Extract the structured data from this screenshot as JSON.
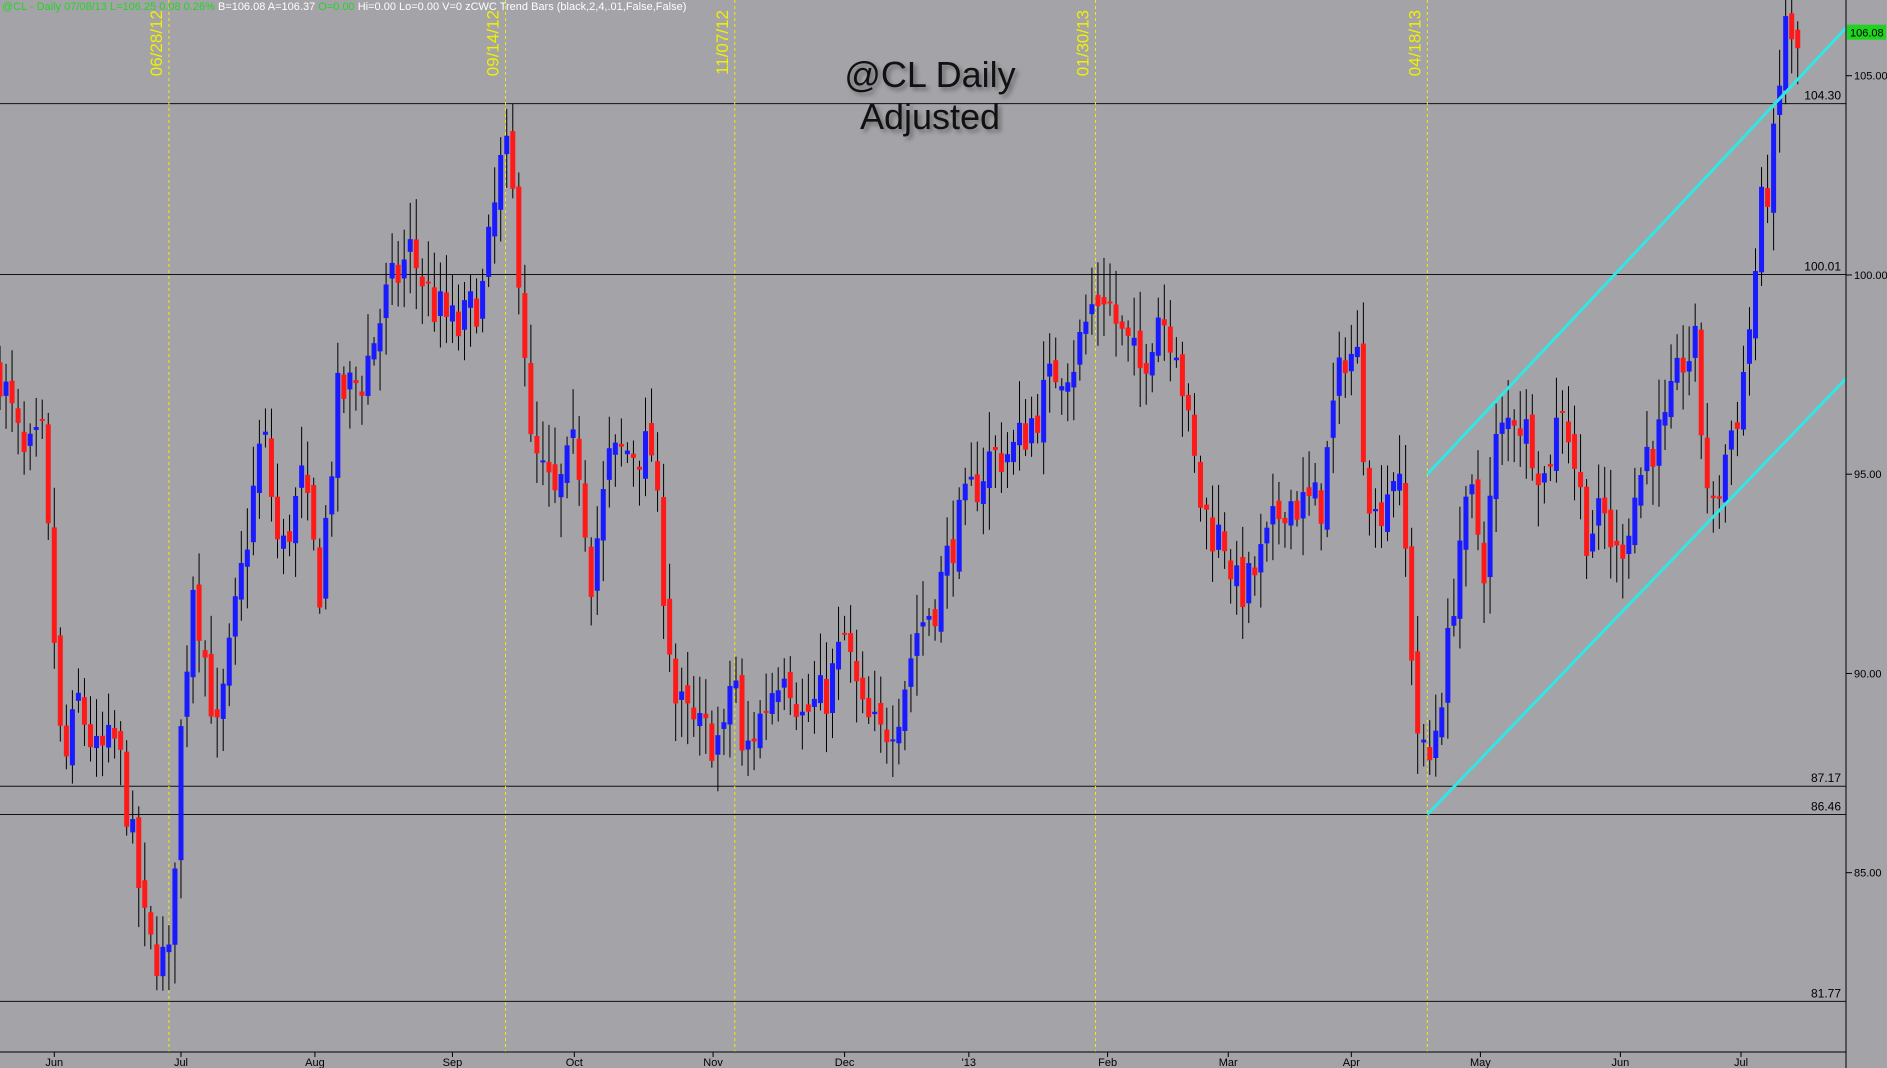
{
  "header": {
    "quote_prefix": "@CL - Daily  07/08/13  L=106.25  0.08  0.26%",
    "bid": "B=106.08",
    "ask": "A=106.37",
    "extra": "O=0.00",
    "stats": "Hi=0.00  Lo=0.00  V=0",
    "indicator": "zCWC Trend Bars (black,2,4,.01,False,False)"
  },
  "title": {
    "line1": "@CL Daily",
    "line2": "Adjusted"
  },
  "colors": {
    "background": "#a3a3a8",
    "up": "#1a1aff",
    "down": "#ff1a1a",
    "channel": "#33e6e6",
    "marker": "#f0f000",
    "level": "#111111"
  },
  "chart_data": {
    "type": "candlestick",
    "ylim": [
      80.5,
      106.9
    ],
    "xlim": [
      0,
      1530
    ],
    "y_ticks": [
      {
        "value": 85,
        "label": "85.00"
      },
      {
        "value": 90,
        "label": "90.00"
      },
      {
        "value": 95,
        "label": "95.00"
      },
      {
        "value": 100,
        "label": "100.00"
      },
      {
        "value": 105,
        "label": "105.00"
      }
    ],
    "last_price": {
      "value": 106.08,
      "label": "106.08"
    },
    "x_ticks": [
      {
        "label": "Jun",
        "x": 45
      },
      {
        "label": "Jul",
        "x": 150
      },
      {
        "label": "Aug",
        "x": 261
      },
      {
        "label": "Sep",
        "x": 375
      },
      {
        "label": "Oct",
        "x": 476
      },
      {
        "label": "Nov",
        "x": 591
      },
      {
        "label": "Dec",
        "x": 700
      },
      {
        "label": "'13",
        "x": 803
      },
      {
        "label": "Feb",
        "x": 918
      },
      {
        "label": "Mar",
        "x": 1018
      },
      {
        "label": "Apr",
        "x": 1120
      },
      {
        "label": "May",
        "x": 1227
      },
      {
        "label": "Jun",
        "x": 1343
      },
      {
        "label": "Jul",
        "x": 1443
      }
    ],
    "horizontal_levels": [
      {
        "value": 104.3,
        "label": "104.30"
      },
      {
        "value": 100.01,
        "label": "100.01"
      },
      {
        "value": 87.17,
        "label": "87.17"
      },
      {
        "value": 86.46,
        "label": "86.46"
      },
      {
        "value": 81.77,
        "label": "81.77"
      }
    ],
    "date_markers": [
      {
        "label": "06/28/12",
        "x": 140
      },
      {
        "label": "09/14/12",
        "x": 419
      },
      {
        "label": "11/07/12",
        "x": 609
      },
      {
        "label": "01/30/13",
        "x": 908
      },
      {
        "label": "04/18/13",
        "x": 1183
      }
    ],
    "channel_lines": [
      {
        "x1": 1183,
        "y1": 95.0,
        "x2": 1530,
        "y2": 106.2
      },
      {
        "x1": 1183,
        "y1": 86.46,
        "x2": 1530,
        "y2": 97.4
      }
    ],
    "price_anchors": [
      [
        0,
        97.6
      ],
      [
        20,
        95.3
      ],
      [
        35,
        95.8
      ],
      [
        52,
        87.4
      ],
      [
        65,
        89.3
      ],
      [
        80,
        87.9
      ],
      [
        97,
        88.3
      ],
      [
        112,
        85.3
      ],
      [
        122,
        83.2
      ],
      [
        132,
        82.9
      ],
      [
        140,
        82.7
      ],
      [
        150,
        88.5
      ],
      [
        160,
        92.4
      ],
      [
        180,
        88.4
      ],
      [
        190,
        90.4
      ],
      [
        205,
        93.5
      ],
      [
        218,
        96.2
      ],
      [
        232,
        92.8
      ],
      [
        250,
        94.8
      ],
      [
        265,
        92.2
      ],
      [
        280,
        96.9
      ],
      [
        300,
        97.4
      ],
      [
        320,
        99.4
      ],
      [
        340,
        100.6
      ],
      [
        360,
        99.2
      ],
      [
        380,
        98.6
      ],
      [
        400,
        99.6
      ],
      [
        418,
        103.3
      ],
      [
        425,
        101.9
      ],
      [
        433,
        99.3
      ],
      [
        440,
        95.6
      ],
      [
        460,
        94.3
      ],
      [
        478,
        95.8
      ],
      [
        490,
        92.5
      ],
      [
        505,
        95.3
      ],
      [
        520,
        95.6
      ],
      [
        540,
        95.6
      ],
      [
        550,
        92.3
      ],
      [
        560,
        89.3
      ],
      [
        575,
        88.6
      ],
      [
        590,
        88.4
      ],
      [
        600,
        88.3
      ],
      [
        608,
        90.6
      ],
      [
        615,
        87.8
      ],
      [
        630,
        88.9
      ],
      [
        650,
        90.4
      ],
      [
        665,
        88.9
      ],
      [
        685,
        89.5
      ],
      [
        700,
        90.9
      ],
      [
        715,
        88.9
      ],
      [
        730,
        88.4
      ],
      [
        745,
        89.2
      ],
      [
        760,
        91.1
      ],
      [
        775,
        91.8
      ],
      [
        790,
        93.4
      ],
      [
        805,
        94.5
      ],
      [
        820,
        95.4
      ],
      [
        840,
        95.6
      ],
      [
        860,
        96.6
      ],
      [
        875,
        97.6
      ],
      [
        890,
        97.9
      ],
      [
        905,
        99.2
      ],
      [
        915,
        99.6
      ],
      [
        930,
        98.4
      ],
      [
        945,
        97.6
      ],
      [
        960,
        99.1
      ],
      [
        975,
        98.4
      ],
      [
        985,
        96.1
      ],
      [
        995,
        94.3
      ],
      [
        1005,
        93.6
      ],
      [
        1015,
        93.4
      ],
      [
        1025,
        92.1
      ],
      [
        1035,
        92.2
      ],
      [
        1050,
        93.2
      ],
      [
        1065,
        94.4
      ],
      [
        1080,
        94.2
      ],
      [
        1095,
        94.3
      ],
      [
        1105,
        96.6
      ],
      [
        1115,
        98.1
      ],
      [
        1125,
        97.9
      ],
      [
        1132,
        95.1
      ],
      [
        1140,
        93.9
      ],
      [
        1155,
        95.1
      ],
      [
        1162,
        94.2
      ],
      [
        1168,
        91.8
      ],
      [
        1173,
        88.9
      ],
      [
        1183,
        87.4
      ],
      [
        1190,
        88.7
      ],
      [
        1200,
        90.6
      ],
      [
        1210,
        93.4
      ],
      [
        1220,
        94.3
      ],
      [
        1230,
        92.8
      ],
      [
        1240,
        95.7
      ],
      [
        1255,
        96.6
      ],
      [
        1270,
        95.8
      ],
      [
        1280,
        94.9
      ],
      [
        1295,
        96.9
      ],
      [
        1305,
        95.3
      ],
      [
        1315,
        93.6
      ],
      [
        1330,
        93.9
      ],
      [
        1340,
        92.9
      ],
      [
        1350,
        93.9
      ],
      [
        1365,
        95.6
      ],
      [
        1380,
        96.1
      ],
      [
        1395,
        97.9
      ],
      [
        1405,
        98.1
      ],
      [
        1412,
        95.4
      ],
      [
        1420,
        93.9
      ],
      [
        1432,
        95.8
      ],
      [
        1442,
        96.8
      ],
      [
        1452,
        99.2
      ],
      [
        1460,
        101.6
      ],
      [
        1468,
        102.6
      ],
      [
        1475,
        104.6
      ],
      [
        1480,
        106.6
      ],
      [
        1485,
        105.6
      ],
      [
        1490,
        105.6
      ]
    ]
  }
}
